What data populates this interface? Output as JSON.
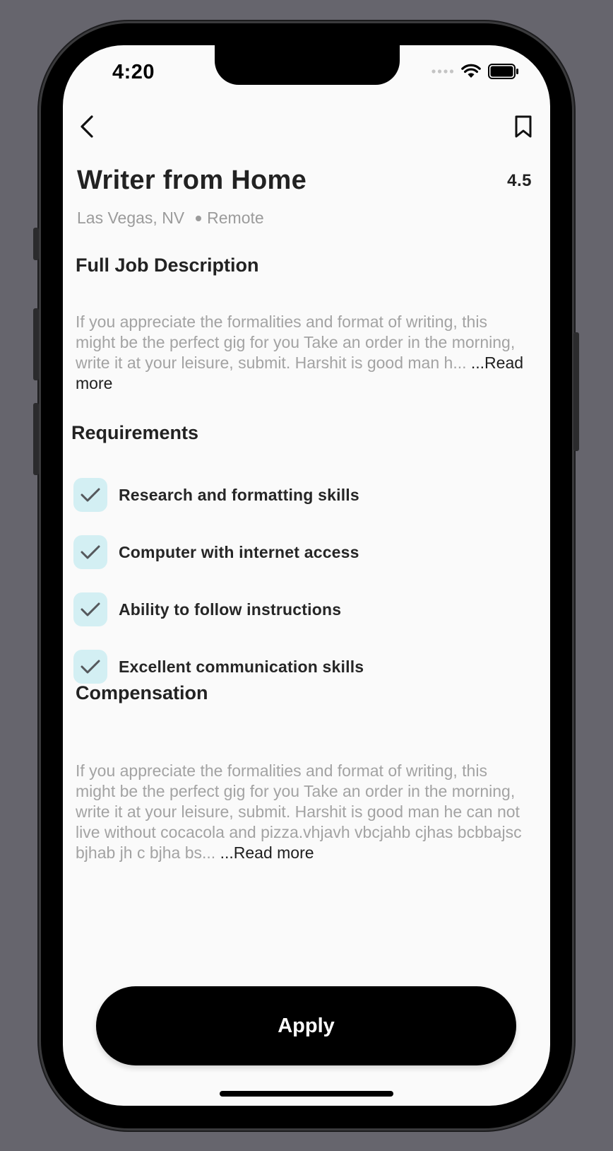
{
  "status_bar": {
    "time": "4:20"
  },
  "nav": {
    "back_icon": "chevron-left-icon",
    "bookmark_icon": "bookmark-icon"
  },
  "job": {
    "title": "Writer from Home",
    "rating": "4.5",
    "location": "Las Vegas, NV",
    "work_type": "Remote"
  },
  "description": {
    "heading": "Full Job Description",
    "text": "If you appreciate the formalities and format of writing, this might be the perfect gig for you Take an order in the morning, write it at your leisure, submit. Harshit is good man h...",
    "read_more": " ...Read more"
  },
  "requirements": {
    "heading": "Requirements",
    "items": [
      {
        "label": "Research and formatting skills",
        "checked": true
      },
      {
        "label": "Computer with internet access",
        "checked": true
      },
      {
        "label": "Ability to follow instructions",
        "checked": true
      },
      {
        "label": "Excellent communication skills",
        "checked": true
      }
    ]
  },
  "compensation": {
    "heading": "Compensation",
    "text": "If you appreciate the formalities and format of writing, this might be the perfect gig for you Take an order in the morning, write it at your leisure, submit. Harshit is good man he can not live without cocacola and pizza.vhjavh vbcjahb cjhas bcbbajsc bjhab jh c bjha bs...",
    "read_more": " ...Read more"
  },
  "actions": {
    "apply_label": "Apply"
  },
  "colors": {
    "background": "#66656d",
    "screen": "#fafafa",
    "check_bg": "#d3eff3",
    "muted_text": "#a3a3a3",
    "button": "#000000"
  }
}
